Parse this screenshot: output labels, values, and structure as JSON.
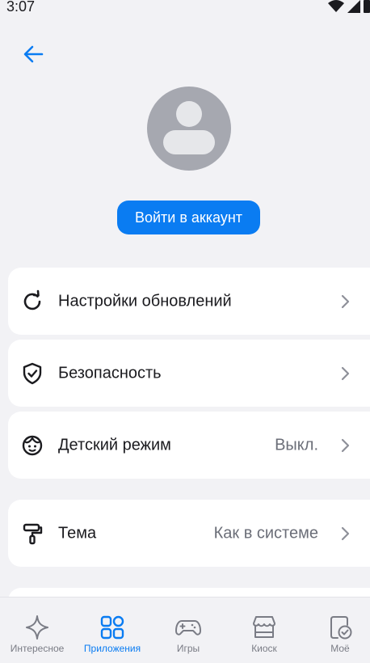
{
  "status_bar": {
    "time": "3:07"
  },
  "header": {
    "back_icon": "arrow-left-icon"
  },
  "profile": {
    "avatar_icon": "user-avatar-icon",
    "login_button": "Войти в аккаунт",
    "accent_color": "#0a7cf2"
  },
  "settings": [
    {
      "icon": "refresh-icon",
      "label": "Настройки обновлений",
      "value": ""
    },
    {
      "icon": "shield-check-icon",
      "label": "Безопасность",
      "value": ""
    },
    {
      "icon": "child-face-icon",
      "label": "Детский режим",
      "value": "Выкл."
    },
    {
      "icon": "paint-roller-icon",
      "label": "Тема",
      "value": "Как в системе"
    }
  ],
  "bottom_nav": {
    "items": [
      {
        "icon": "sparkle-icon",
        "label": "Интересное",
        "active": false
      },
      {
        "icon": "apps-grid-icon",
        "label": "Приложения",
        "active": true
      },
      {
        "icon": "gamepad-icon",
        "label": "Игры",
        "active": false
      },
      {
        "icon": "kiosk-icon",
        "label": "Киоск",
        "active": false
      },
      {
        "icon": "my-apps-icon",
        "label": "Моё",
        "active": false
      }
    ]
  }
}
